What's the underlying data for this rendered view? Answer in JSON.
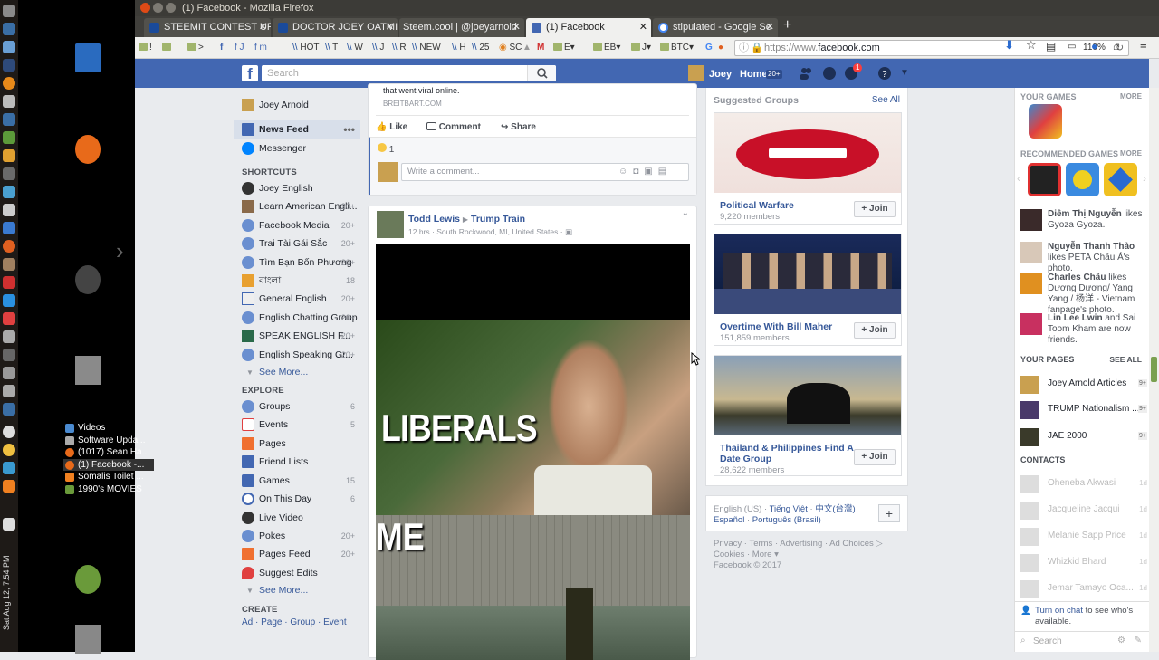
{
  "window": {
    "title": "(1) Facebook - Mozilla Firefox"
  },
  "clock": "Sat Aug 12, 7:54 PM",
  "taskmenu": [
    "Videos",
    "Software Upda...",
    "(1017) Sean Ha...",
    "(1) Facebook -...",
    "Somalis Toilet ...",
    "1990's MOVIES"
  ],
  "tabs": [
    "STEEMIT CONTEST UP",
    "DOCTOR JOEY OATMI",
    "Steem.cool | @joeyarnold",
    "(1) Facebook",
    "stipulated - Google Se"
  ],
  "bookmarks": [
    "HOT",
    "T",
    "W",
    "J",
    "R",
    "NEW",
    "H",
    "25",
    "SC",
    "M",
    "E",
    "EB",
    "J",
    "BTC",
    "G"
  ],
  "url": {
    "prefix": "https://www.",
    "domain": "facebook.com",
    "zoom": "110%"
  },
  "header": {
    "search_placeholder": "Search",
    "user": "Joey",
    "home": "Home",
    "home_count": "20+",
    "notif_count": "1"
  },
  "leftnav": {
    "profile": "Joey Arnold",
    "newsfeed": "News Feed",
    "messenger": "Messenger",
    "shortcuts_title": "SHORTCUTS",
    "shortcuts": [
      {
        "label": "Joey English",
        "count": ""
      },
      {
        "label": "Learn American Engli...",
        "count": "20+"
      },
      {
        "label": "Facebook Media",
        "count": "20+"
      },
      {
        "label": "Trai Tài Gái Sắc",
        "count": "20+"
      },
      {
        "label": "Tìm Bạn Bốn Phương",
        "count": "20+"
      },
      {
        "label": "বাংলা",
        "count": "18"
      },
      {
        "label": "General English",
        "count": "20+"
      },
      {
        "label": "English Chatting Group",
        "count": "20+"
      },
      {
        "label": "SPEAK ENGLISH F...",
        "count": "20+"
      },
      {
        "label": "English Speaking Gr...",
        "count": "20+"
      }
    ],
    "see_more_1": "See More...",
    "explore_title": "EXPLORE",
    "explore": [
      {
        "label": "Groups",
        "count": "6"
      },
      {
        "label": "Events",
        "count": "5"
      },
      {
        "label": "Pages",
        "count": ""
      },
      {
        "label": "Friend Lists",
        "count": ""
      },
      {
        "label": "Games",
        "count": "15"
      },
      {
        "label": "On This Day",
        "count": "6"
      },
      {
        "label": "Live Video",
        "count": ""
      },
      {
        "label": "Pokes",
        "count": "20+"
      },
      {
        "label": "Pages Feed",
        "count": "20+"
      },
      {
        "label": "Suggest Edits",
        "count": ""
      }
    ],
    "see_more_2": "See More...",
    "create_title": "CREATE",
    "create_links": [
      "Ad",
      "Page",
      "Group",
      "Event"
    ]
  },
  "post1": {
    "snippet": "that went viral online.",
    "source": "BREITBART.COM",
    "like": "Like",
    "comment": "Comment",
    "share": "Share",
    "reaction_count": "1",
    "comment_placeholder": "Write a comment..."
  },
  "post2": {
    "author": "Todd Lewis",
    "group": "Trump Train",
    "time": "12 hrs",
    "location": "South Rockwood, MI, United States",
    "meme_top": "LIBERALS",
    "meme_bottom": "ME"
  },
  "suggested": {
    "title": "Suggested Groups",
    "see_all": "See All",
    "join": "Join",
    "groups": [
      {
        "name": "Political Warfare",
        "members": "9,220 members"
      },
      {
        "name": "Overtime With Bill Maher",
        "members": "151,859 members"
      },
      {
        "name": "Thailand & Philippines Find A Date Group",
        "members": "28,622 members"
      }
    ]
  },
  "footer": {
    "languages": [
      "English (US)",
      "Tiếng Việt",
      "中文(台灣)",
      "Español",
      "Português (Brasil)"
    ],
    "links": [
      "Privacy",
      "Terms",
      "Advertising",
      "Ad Choices",
      "Cookies",
      "More"
    ],
    "copyright": "Facebook © 2017"
  },
  "chat": {
    "your_games": "YOUR GAMES",
    "more": "MORE",
    "recommended_games": "RECOMMENDED GAMES",
    "ticker": [
      {
        "name": "Diêm Thị Nguyễn",
        "text": "likes Gyoza Gyoza."
      },
      {
        "name": "Nguyễn Thanh Thảo",
        "text": "likes PETA Châu Á's photo."
      },
      {
        "name": "Charles Châu",
        "text": "likes Dương Dương/ Yang Yang / 杨洋 - Vietnam fanpage's photo."
      },
      {
        "name": "Lin Lee Lwin",
        "text": "and Sai Toom Kham are now friends."
      }
    ],
    "your_pages": "YOUR PAGES",
    "see_all": "SEE ALL",
    "pages": [
      {
        "name": "Joey Arnold Articles",
        "count": "9+"
      },
      {
        "name": "TRUMP Nationalism ...",
        "count": "9+"
      },
      {
        "name": "JAE 2000",
        "count": "9+"
      }
    ],
    "contacts_title": "CONTACTS",
    "contacts": [
      {
        "name": "Oheneba Akwasi",
        "time": "1d"
      },
      {
        "name": "Jacqueline Jacqui",
        "time": "1d"
      },
      {
        "name": "Melanie Sapp Price",
        "time": "1d"
      },
      {
        "name": "Whizkid Bhard",
        "time": "1d"
      },
      {
        "name": "Jemar Tamayo Oca...",
        "time": "1d"
      }
    ],
    "turn_on": "Turn on chat",
    "turn_on_rest": "to see who's available.",
    "search": "Search"
  },
  "colors": {
    "fb_blue": "#4267b2",
    "link": "#365899"
  }
}
